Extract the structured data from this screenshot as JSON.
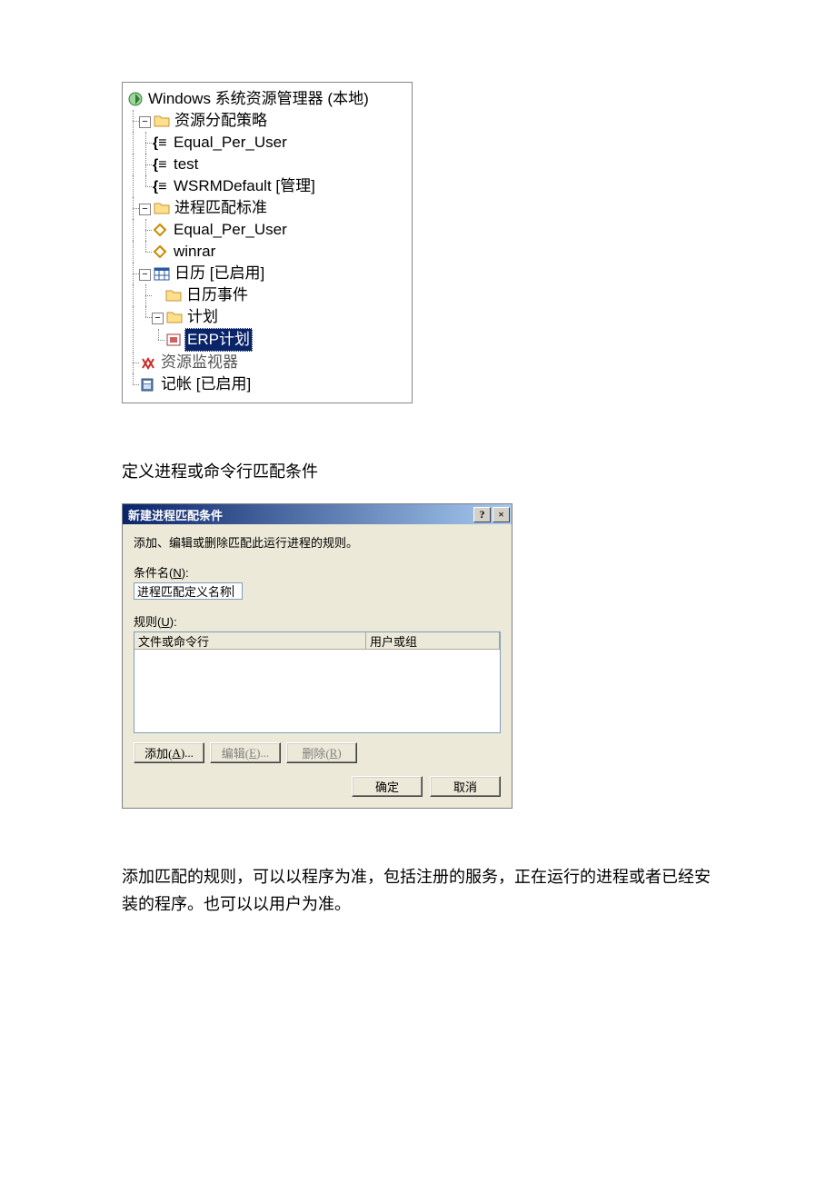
{
  "tree": {
    "root": "Windows 系统资源管理器 (本地)",
    "folder1": "资源分配策略",
    "f1_a": "Equal_Per_User",
    "f1_b": "test",
    "f1_c": "WSRMDefault  [管理]",
    "folder2": "进程匹配标准",
    "f2_a": "Equal_Per_User",
    "f2_b": "winrar",
    "calendar": "日历 [已启用]",
    "cal_events": "日历事件",
    "cal_plan": "计划",
    "erp_plan": "ERP计划",
    "monitor": "资源监视器",
    "accounting": "记帐 [已启用]"
  },
  "para1": "定义进程或命令行匹配条件",
  "dialog": {
    "title": "新建进程匹配条件",
    "desc": "添加、编辑或删除匹配此运行进程的规则。",
    "name_label_pre": "条件名(",
    "name_label_u": "N",
    "name_label_post": "):",
    "name_value": "进程匹配定义名称",
    "rules_label_pre": "规则(",
    "rules_label_u": "U",
    "rules_label_post": "):",
    "col1": "文件或命令行",
    "col2": "用户或组",
    "btn_add_pre": "添加(",
    "btn_add_u": "A",
    "btn_add_post": ")...",
    "btn_edit_pre": "编辑(",
    "btn_edit_u": "E",
    "btn_edit_post": ")...",
    "btn_del_pre": "删除(",
    "btn_del_u": "R",
    "btn_del_post": ")",
    "ok": "确定",
    "cancel": "取消"
  },
  "para2": "添加匹配的规则，可以以程序为准，包括注册的服务，正在运行的进程或者已经安装的程序。也可以以用户为准。"
}
